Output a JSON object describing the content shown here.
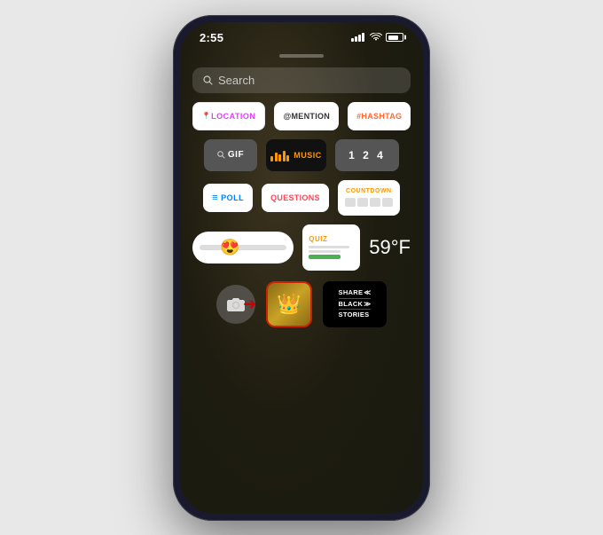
{
  "phone": {
    "status_bar": {
      "time": "2:55",
      "signal": "●●●●",
      "wifi": "wifi",
      "battery": "battery"
    },
    "search": {
      "placeholder": "Search"
    },
    "sticker_rows": [
      {
        "id": "row1",
        "stickers": [
          {
            "id": "location",
            "label": "LOCATION",
            "type": "location"
          },
          {
            "id": "mention",
            "label": "@MENTION",
            "type": "mention"
          },
          {
            "id": "hashtag",
            "label": "#HASHTAG",
            "type": "hashtag"
          }
        ]
      },
      {
        "id": "row2",
        "stickers": [
          {
            "id": "gif",
            "label": "GIF",
            "type": "gif"
          },
          {
            "id": "music",
            "label": "MUSIC",
            "type": "music"
          },
          {
            "id": "counter",
            "label": "1  2  4",
            "type": "counter"
          }
        ]
      },
      {
        "id": "row3",
        "stickers": [
          {
            "id": "poll",
            "label": "POLL",
            "type": "poll"
          },
          {
            "id": "questions",
            "label": "QUESTIONS",
            "type": "questions"
          },
          {
            "id": "countdown",
            "label": "COUNTDOWN",
            "type": "countdown"
          }
        ]
      },
      {
        "id": "row4",
        "stickers": [
          {
            "id": "emoji-slider",
            "label": "😍",
            "type": "emoji-slider"
          },
          {
            "id": "quiz",
            "label": "QUIZ",
            "type": "quiz"
          },
          {
            "id": "temp",
            "label": "59°F",
            "type": "temp"
          }
        ]
      }
    ],
    "bottom": {
      "camera_label": "📷",
      "crown_emoji": "👑",
      "share_line1": "SHARE",
      "share_line2": "BLACK",
      "share_line3": "STORIES"
    }
  }
}
